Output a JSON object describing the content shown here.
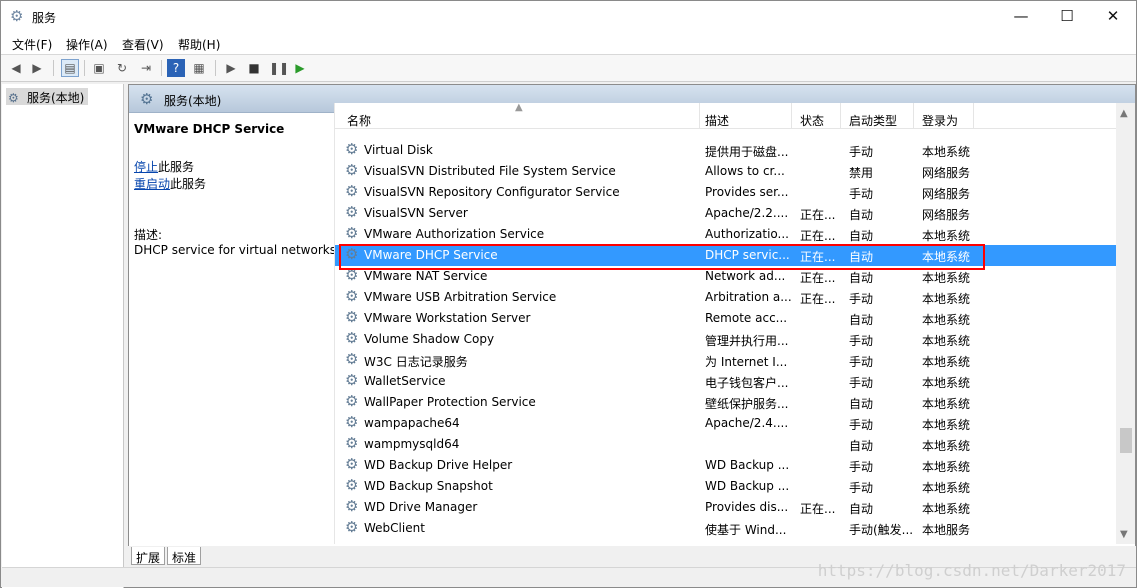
{
  "window": {
    "title": "服务",
    "controls": {
      "minimize": "—",
      "maximize": "☐",
      "close": "✕"
    }
  },
  "menubar": {
    "items": [
      "文件(F)",
      "操作(A)",
      "查看(V)",
      "帮助(H)"
    ]
  },
  "toolbar": {
    "icons": [
      "back-icon",
      "forward-icon",
      "show-hide-console-tree-icon",
      "properties-icon",
      "refresh-icon",
      "export-list-icon",
      "help-icon",
      "show-hide-action-pane-icon",
      "start-service-icon",
      "stop-service-icon",
      "pause-service-icon",
      "restart-service-icon"
    ]
  },
  "tree": {
    "selected_item": "服务(本地)"
  },
  "main": {
    "header_title": "服务(本地)",
    "description_panel": {
      "service_name": "VMware DHCP Service",
      "stop_link": "停止",
      "stop_suffix": "此服务",
      "restart_link": "重启动",
      "restart_suffix": "此服务",
      "description_label": "描述:",
      "description_text": "DHCP service for virtual networks."
    }
  },
  "columns": [
    "名称",
    "描述",
    "状态",
    "启动类型",
    "登录为"
  ],
  "services": [
    {
      "name": "Virtual Disk",
      "desc": "提供用于磁盘...",
      "status": "",
      "startup": "手动",
      "logon": "本地系统"
    },
    {
      "name": "VisualSVN Distributed File System Service",
      "desc": "Allows to cr...",
      "status": "",
      "startup": "禁用",
      "logon": "网络服务"
    },
    {
      "name": "VisualSVN Repository Configurator Service",
      "desc": "Provides ser...",
      "status": "",
      "startup": "手动",
      "logon": "网络服务"
    },
    {
      "name": "VisualSVN Server",
      "desc": "Apache/2.2....",
      "status": "正在...",
      "startup": "自动",
      "logon": "网络服务"
    },
    {
      "name": "VMware Authorization Service",
      "desc": "Authorizatio...",
      "status": "正在...",
      "startup": "自动",
      "logon": "本地系统"
    },
    {
      "name": "VMware DHCP Service",
      "desc": "DHCP servic...",
      "status": "正在...",
      "startup": "自动",
      "logon": "本地系统",
      "selected": true
    },
    {
      "name": "VMware NAT Service",
      "desc": "Network ad...",
      "status": "正在...",
      "startup": "自动",
      "logon": "本地系统"
    },
    {
      "name": "VMware USB Arbitration Service",
      "desc": "Arbitration a...",
      "status": "正在...",
      "startup": "手动",
      "logon": "本地系统"
    },
    {
      "name": "VMware Workstation Server",
      "desc": "Remote acc...",
      "status": "",
      "startup": "自动",
      "logon": "本地系统"
    },
    {
      "name": "Volume Shadow Copy",
      "desc": "管理并执行用...",
      "status": "",
      "startup": "手动",
      "logon": "本地系统"
    },
    {
      "name": "W3C 日志记录服务",
      "desc": "为 Internet I...",
      "status": "",
      "startup": "手动",
      "logon": "本地系统"
    },
    {
      "name": "WalletService",
      "desc": "电子钱包客户...",
      "status": "",
      "startup": "手动",
      "logon": "本地系统"
    },
    {
      "name": "WallPaper Protection Service",
      "desc": "壁纸保护服务...",
      "status": "",
      "startup": "自动",
      "logon": "本地系统"
    },
    {
      "name": "wampapache64",
      "desc": "Apache/2.4....",
      "status": "",
      "startup": "手动",
      "logon": "本地系统"
    },
    {
      "name": "wampmysqld64",
      "desc": "",
      "status": "",
      "startup": "自动",
      "logon": "本地系统"
    },
    {
      "name": "WD Backup Drive Helper",
      "desc": "WD Backup ...",
      "status": "",
      "startup": "手动",
      "logon": "本地系统"
    },
    {
      "name": "WD Backup Snapshot",
      "desc": "WD Backup ...",
      "status": "",
      "startup": "手动",
      "logon": "本地系统"
    },
    {
      "name": "WD Drive Manager",
      "desc": "Provides dis...",
      "status": "正在...",
      "startup": "自动",
      "logon": "本地系统"
    },
    {
      "name": "WebClient",
      "desc": "使基于 Wind...",
      "status": "",
      "startup": "手动(触发...",
      "logon": "本地服务"
    }
  ],
  "tabs": [
    "扩展",
    "标准"
  ],
  "watermark": "https://blog.csdn.net/Darker2017"
}
